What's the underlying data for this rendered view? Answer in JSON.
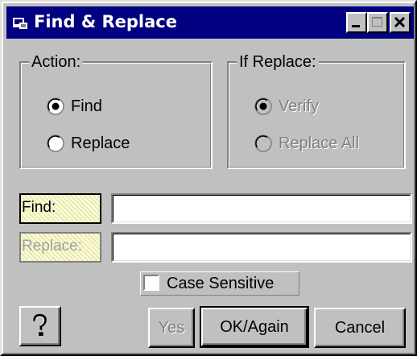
{
  "window": {
    "title": "Find & Replace",
    "app_icon": "window-icon",
    "controls": {
      "minimize": "minimize-icon",
      "maximize": "maximize-icon",
      "close": "close-icon"
    }
  },
  "action_group": {
    "legend": "Action:",
    "options": [
      {
        "label": "Find",
        "selected": true
      },
      {
        "label": "Replace",
        "selected": false
      }
    ]
  },
  "replace_group": {
    "legend": "If Replace:",
    "enabled": false,
    "options": [
      {
        "label": "Verify",
        "selected": true
      },
      {
        "label": "Replace All",
        "selected": false
      }
    ]
  },
  "fields": {
    "find": {
      "label": "Find:",
      "value": ""
    },
    "replace": {
      "label": "Replace:",
      "value": "",
      "enabled": false
    }
  },
  "case_sensitive": {
    "label": "Case Sensitive",
    "checked": false
  },
  "buttons": {
    "help_icon": "help-icon",
    "yes": "Yes",
    "ok_again": "OK/Again",
    "cancel": "Cancel"
  },
  "colors": {
    "titlebar": "#000080",
    "face": "#c0c0c0",
    "disabled_text": "#808080",
    "label_bg": "#f2f2c8"
  }
}
